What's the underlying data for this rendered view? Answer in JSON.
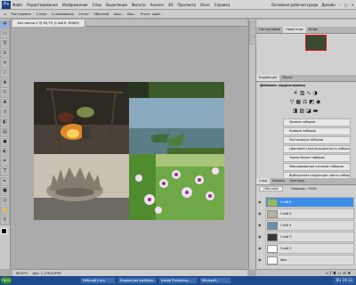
{
  "app": {
    "logo": "Ps",
    "menus": [
      "Файл",
      "Редактирование",
      "Изображение",
      "Слои",
      "Выделение",
      "Фильтр",
      "Анализ",
      "3D",
      "Просмотр",
      "Окно",
      "Справка"
    ],
    "workspace": "Основная рабочая среда",
    "design_label": "Дизайн",
    "zoom": "66,7"
  },
  "options": {
    "items": [
      "Растушевка:",
      "0 пикс",
      "Сглаживание",
      "Стиль:",
      "Обычный",
      "Шир.:",
      "Выс.:",
      "Уточн. край..."
    ]
  },
  "document": {
    "tab": "Без имени-1 @ 66,7% (Слой 6, RGB/8)",
    "status_zoom": "66,67%",
    "status_doc": "Док: 1,17М/4,69М"
  },
  "panels": {
    "navigator_tabs": [
      "Гистограмма",
      "Навигатор",
      "Инфо"
    ],
    "adjust_tabs": [
      "Коррекция",
      "Маски"
    ],
    "adjust_title": "Добавить корректировку",
    "adjust_presets": [
      "Уровни наборов",
      "Кривые наборов",
      "Экспозиция наборов",
      "Цветовой тон/насыщенность наборов",
      "Черно-белое наборов",
      "Микширование каналов наборов",
      "Выборочная коррекция цвета наборов"
    ],
    "layers_tabs": [
      "Слои",
      "Каналы",
      "Контуры"
    ],
    "layers_mode": "Обычные",
    "opacity_label": "Непрозр.: 100%",
    "layers": [
      {
        "name": "Слой 6",
        "selected": true
      },
      {
        "name": "Слой 5",
        "selected": false
      },
      {
        "name": "Слой 4",
        "selected": false
      },
      {
        "name": "Слой 3",
        "selected": false
      },
      {
        "name": "Слой 2",
        "selected": false
      },
      {
        "name": "Фон",
        "selected": false
      }
    ]
  },
  "taskbar": {
    "start": "пуск",
    "tasks": [
      "Рабочий стол",
      "Коррекция изображ...",
      "Adobe Photoshop...",
      "Microsoft..."
    ],
    "lang": "RU",
    "time": "19:13"
  },
  "colors": {
    "selection": "#3d8ee8",
    "taskbar": "#1f4a8c"
  }
}
